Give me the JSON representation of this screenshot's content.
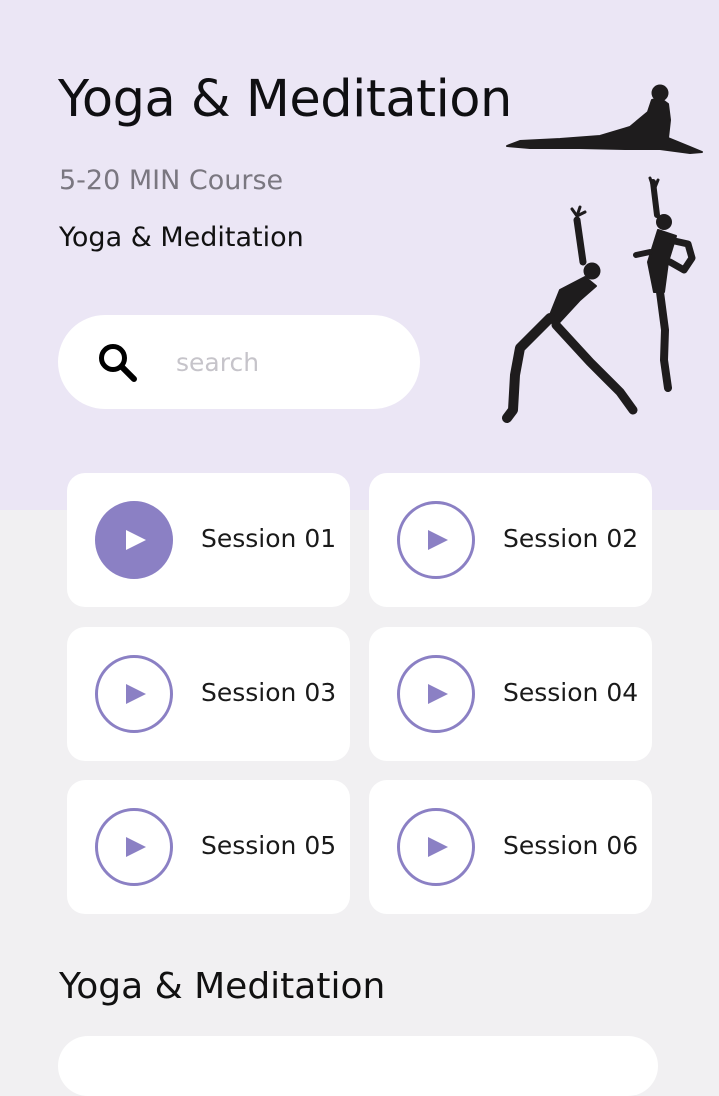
{
  "header": {
    "title": "Yoga & Meditation",
    "subtitle": "5-20 MIN Course",
    "subheading": "Yoga & Meditation"
  },
  "search": {
    "placeholder": "search",
    "value": "",
    "icon": "search-icon"
  },
  "illustration": {
    "icon": "yoga-poses-illustration"
  },
  "sessions": [
    {
      "label": "Session 01",
      "active": true
    },
    {
      "label": "Session 02",
      "active": false
    },
    {
      "label": "Session 03",
      "active": false
    },
    {
      "label": "Session 04",
      "active": false
    },
    {
      "label": "Session 05",
      "active": false
    },
    {
      "label": "Session 06",
      "active": false
    }
  ],
  "section": {
    "title": "Yoga & Meditation"
  },
  "colors": {
    "hero_background": "#ebe6f5",
    "page_background": "#f1f0f2",
    "accent": "#8b80c4",
    "card": "#ffffff",
    "silhouette": "#1e1c1d"
  }
}
